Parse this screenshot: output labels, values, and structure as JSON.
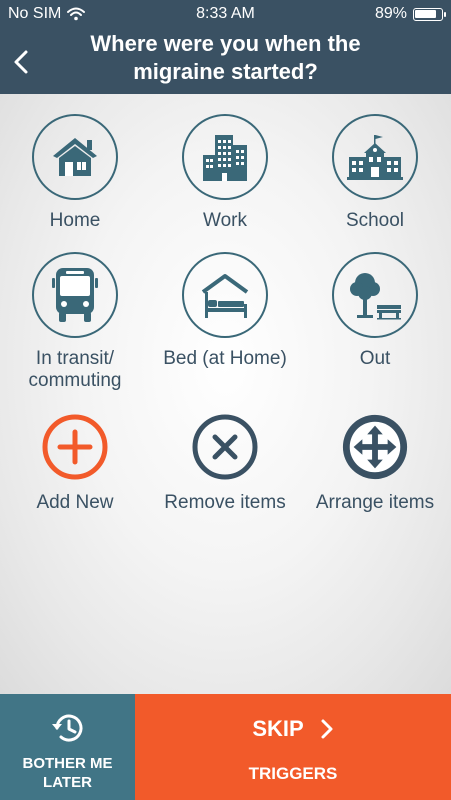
{
  "status_bar": {
    "carrier": "No SIM",
    "time": "8:33 AM",
    "battery": "89%",
    "battery_level": 0.89
  },
  "header": {
    "title": "Where were you when the migraine started?"
  },
  "locations": [
    {
      "label": "Home",
      "icon": "home-icon"
    },
    {
      "label": "Work",
      "icon": "office-building-icon"
    },
    {
      "label": "School",
      "icon": "school-icon"
    },
    {
      "label": "In transit/ commuting",
      "icon": "bus-icon"
    },
    {
      "label": "Bed (at Home)",
      "icon": "bed-icon"
    },
    {
      "label": "Out",
      "icon": "tree-bench-icon"
    }
  ],
  "actions": [
    {
      "label": "Add New",
      "icon": "plus-circle-icon",
      "color": "#f25a2a"
    },
    {
      "label": "Remove items",
      "icon": "x-circle-icon",
      "color": "#3a5163"
    },
    {
      "label": "Arrange items",
      "icon": "move-arrows-icon",
      "color": "#3a5163"
    }
  ],
  "footer": {
    "bother_label": "BOTHER ME LATER",
    "skip_label": "SKIP",
    "triggers_label": "TRIGGERS"
  },
  "colors": {
    "header_bg": "#3a5163",
    "icon_stroke": "#3a6878",
    "bother_bg": "#417586",
    "skip_bg": "#f25a2a"
  }
}
